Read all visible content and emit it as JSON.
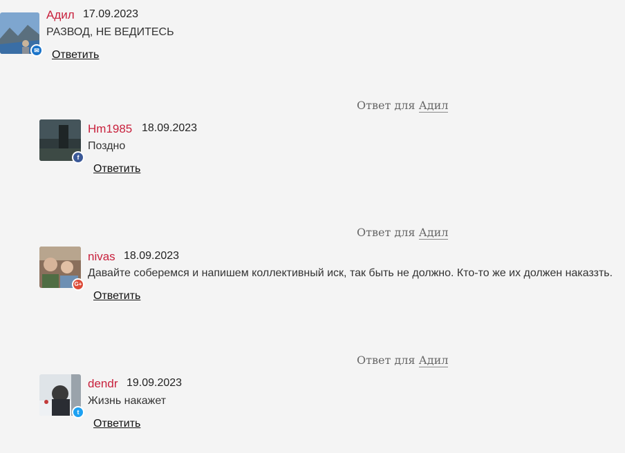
{
  "comments": [
    {
      "author": "Адил",
      "date": "17.09.2023",
      "text": "РАЗВОД, НЕ ВЕДИТЕСЬ",
      "reply": "Ответить",
      "badge": "mail-icon",
      "badge_color": "#1a73c9"
    },
    {
      "reply_to_label": "Ответ для",
      "reply_to_name": "Адил",
      "author": "Hm1985",
      "date": "18.09.2023",
      "text": "Поздно",
      "reply": "Ответить",
      "badge": "facebook-icon",
      "badge_color": "#3b5998"
    },
    {
      "reply_to_label": "Ответ для",
      "reply_to_name": "Адил",
      "author": "nivas",
      "date": "18.09.2023",
      "text": "Давайте соберемся и напишем коллективный иск, так быть не должно. Кто-то же их должен наказзть.",
      "reply": "Ответить",
      "badge": "google-plus-icon",
      "badge_color": "#dd4b39"
    },
    {
      "reply_to_label": "Ответ для",
      "reply_to_name": "Адил",
      "author": "dendr",
      "date": "19.09.2023",
      "text": "Жизнь накажет",
      "reply": "Ответить",
      "badge": "twitter-icon",
      "badge_color": "#1da1f2"
    }
  ]
}
